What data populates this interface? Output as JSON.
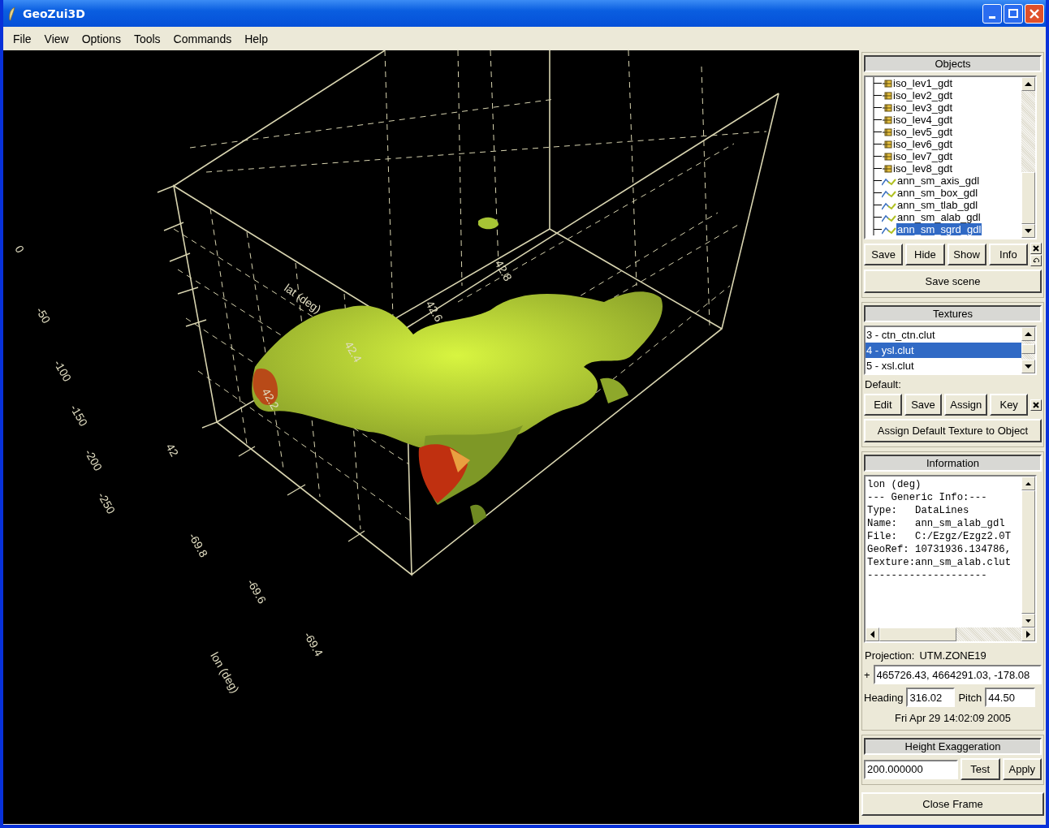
{
  "window": {
    "title": "GeoZui3D"
  },
  "menu": [
    "File",
    "View",
    "Options",
    "Tools",
    "Commands",
    "Help"
  ],
  "scene": {
    "labels": [
      {
        "text": "0"
      },
      {
        "text": "-50"
      },
      {
        "text": "-100"
      },
      {
        "text": "-150"
      },
      {
        "text": "-200"
      },
      {
        "text": "-250"
      },
      {
        "text": "42"
      },
      {
        "text": "-69.8"
      },
      {
        "text": "-69.6"
      },
      {
        "text": "-69.4"
      },
      {
        "text": "lon (deg)"
      },
      {
        "text": "lat (deg)"
      },
      {
        "text": "42.8"
      },
      {
        "text": "42.6"
      },
      {
        "text": "42.4"
      },
      {
        "text": "42.2"
      }
    ]
  },
  "objects": {
    "title": "Objects",
    "items": [
      {
        "name": "iso_lev1_gdt",
        "kind": "volume",
        "selected": false
      },
      {
        "name": "iso_lev2_gdt",
        "kind": "volume",
        "selected": false
      },
      {
        "name": "iso_lev3_gdt",
        "kind": "volume",
        "selected": false
      },
      {
        "name": "iso_lev4_gdt",
        "kind": "volume",
        "selected": false
      },
      {
        "name": "iso_lev5_gdt",
        "kind": "volume",
        "selected": false
      },
      {
        "name": "iso_lev6_gdt",
        "kind": "volume",
        "selected": false
      },
      {
        "name": "iso_lev7_gdt",
        "kind": "volume",
        "selected": false
      },
      {
        "name": "iso_lev8_gdt",
        "kind": "volume",
        "selected": false
      },
      {
        "name": "ann_sm_axis_gdl",
        "kind": "lines",
        "selected": false
      },
      {
        "name": "ann_sm_box_gdl",
        "kind": "lines",
        "selected": false
      },
      {
        "name": "ann_sm_tlab_gdl",
        "kind": "lines",
        "selected": false
      },
      {
        "name": "ann_sm_alab_gdl",
        "kind": "lines",
        "selected": false
      },
      {
        "name": "ann_sm_sgrd_gdl",
        "kind": "lines",
        "selected": true
      }
    ],
    "buttons": [
      "Save",
      "Hide",
      "Show",
      "Info"
    ],
    "save_scene": "Save scene"
  },
  "textures": {
    "title": "Textures",
    "items": [
      {
        "name": "3 - ctn_ctn.clut",
        "selected": false
      },
      {
        "name": "4 - ysl.clut",
        "selected": true
      },
      {
        "name": "5 - xsl.clut",
        "selected": false
      }
    ],
    "default_label": "Default:",
    "buttons": [
      "Edit",
      "Save",
      "Assign",
      "Key"
    ],
    "assign_default": "Assign Default Texture to Object"
  },
  "information": {
    "title": "Information",
    "lines": [
      "lon (deg)",
      "--- Generic Info:---",
      "Type:   DataLines",
      "Name:   ann_sm_alab_gdl",
      "File:   C:/Ezgz/Ezgz2.0T",
      "GeoRef: 10731936.134786,",
      "Texture:ann_sm_alab.clut",
      "--------------------"
    ],
    "projection_label": "Projection:",
    "projection": "UTM.ZONE19",
    "position_prefix": "+",
    "position": "465726.43, 4664291.03, -178.08",
    "heading_label": "Heading",
    "heading": "316.02",
    "pitch_label": "Pitch",
    "pitch": "44.50",
    "timestamp": "Fri Apr 29 14:02:09 2005"
  },
  "height": {
    "title": "Height Exaggeration",
    "value": "200.000000",
    "buttons": [
      "Test",
      "Apply"
    ]
  },
  "close_frame": "Close Frame"
}
